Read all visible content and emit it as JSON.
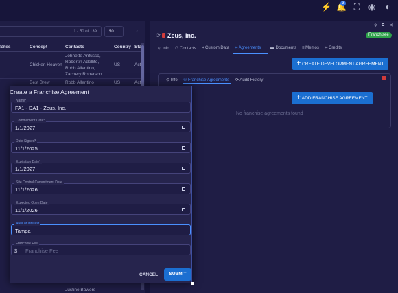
{
  "topbar": {
    "bolt": "⚡",
    "bell": "🔔",
    "badge_count": "3",
    "fullscreen": "⛶",
    "user": "◉",
    "palette": "◐"
  },
  "table": {
    "pager": "1 - 50 of 139",
    "per_page": "50",
    "next": "›",
    "headers": [
      "Sites",
      "Concept",
      "Contacts",
      "Country",
      "Sta"
    ],
    "rows": [
      {
        "concept": "Chicken Heaven",
        "contacts": [
          "Johnette Anfusso,",
          "Robertin Adellito,",
          "Robb Allentino,",
          "Zachery Roberson"
        ],
        "country": "US",
        "status": "Acti"
      },
      {
        "concept": "Best Brew",
        "contacts": [
          "Robb Allentino"
        ],
        "country": "US",
        "status": "Acti"
      }
    ],
    "last_contact": "Justine Bowers"
  },
  "detail": {
    "title": "Zeus, Inc.",
    "badge": "Franchisee",
    "tabs": [
      "Info",
      "Contacts",
      "Custom Data",
      "Agreements",
      "Documents",
      "Memos",
      "Credits"
    ],
    "create_button": "CREATE DEVELOPMENT AGREEMENT",
    "subtabs": [
      "Info",
      "Franchise Agreements",
      "Audit History"
    ],
    "add_button": "ADD FRANCHISE AGREEMENT",
    "empty_text": "No franchise agreements found"
  },
  "modal": {
    "title": "Create a Franchise Agreement",
    "fields": [
      {
        "label": "Name*",
        "value": "FA1 - DA1 - Zeus, Inc."
      },
      {
        "label": "Commitment Date*",
        "value": "1/1/2027"
      },
      {
        "label": "Date Signed*",
        "value": "11/1/2025"
      },
      {
        "label": "Expiration Date*",
        "value": "1/1/2027"
      },
      {
        "label": "Site Control Commitment Date",
        "value": "11/1/2026"
      },
      {
        "label": "Expected Open Date",
        "value": "11/1/2026"
      },
      {
        "label": "Area of Interest",
        "value": "Tampa"
      },
      {
        "label": "Franchise Fee",
        "value": "",
        "placeholder": "Franchise Fee",
        "prefix": "$"
      }
    ],
    "cancel": "CANCEL",
    "submit": "SUBMIT"
  }
}
